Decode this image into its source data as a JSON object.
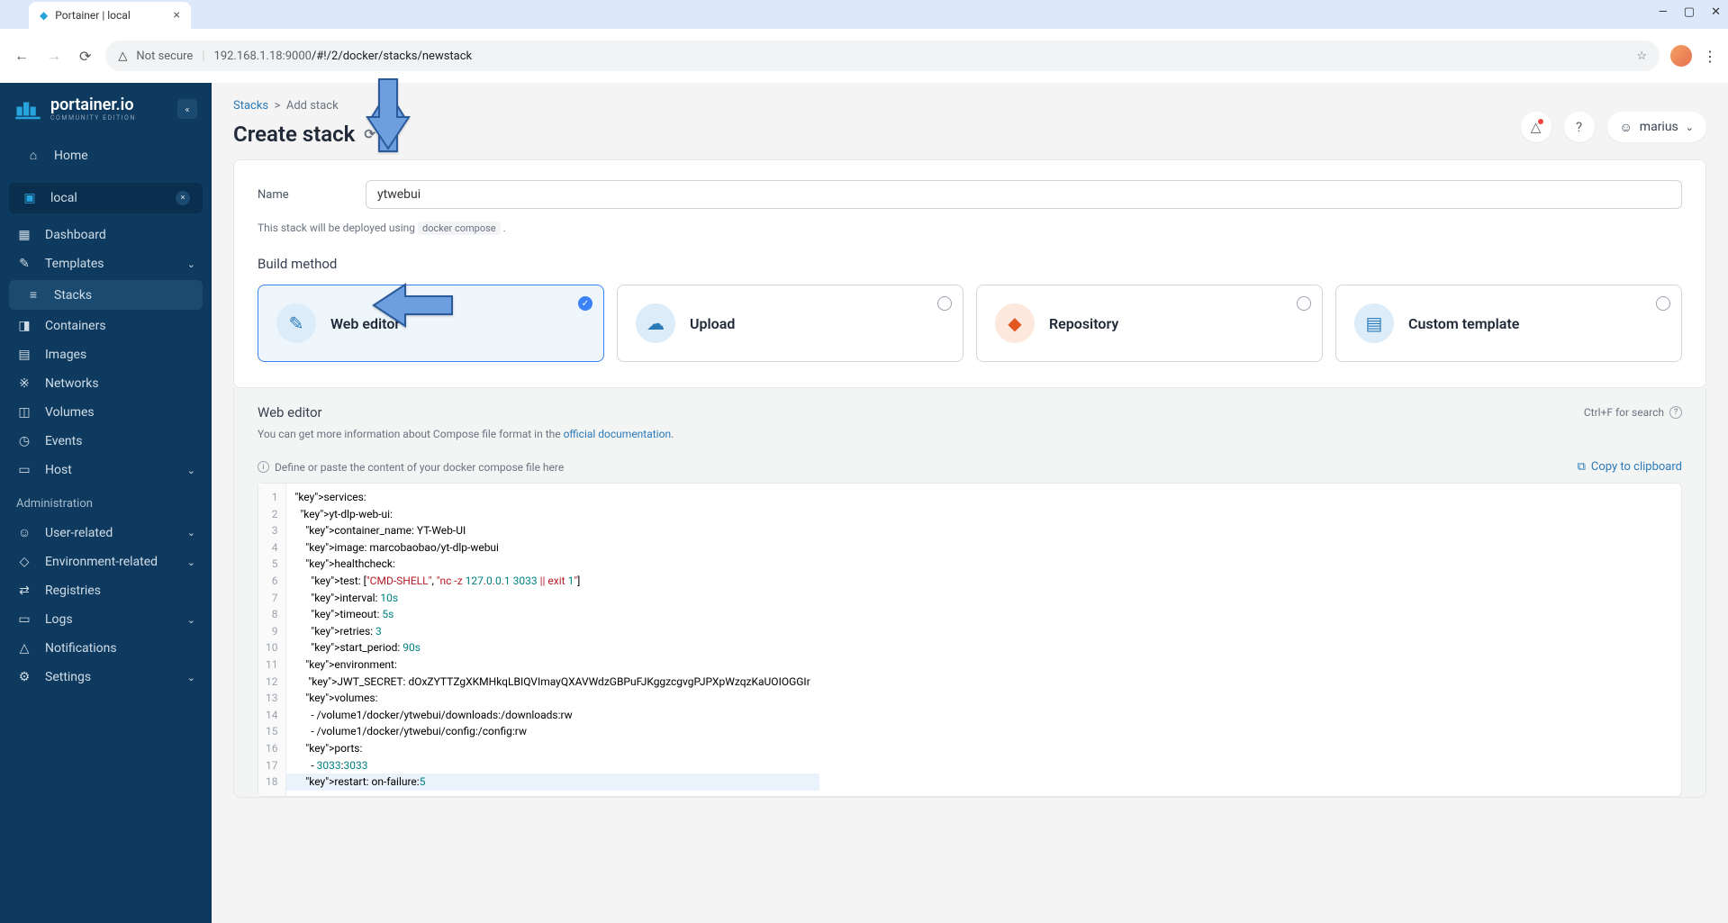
{
  "browser": {
    "tab_title": "Portainer | local",
    "security": "Not secure",
    "url_host": "192.168.1.18:9000",
    "url_path": "/#!/2/docker/stacks/newstack"
  },
  "sidebar": {
    "logo_main": "portainer.io",
    "logo_sub": "COMMUNITY EDITION",
    "home": "Home",
    "env_name": "local",
    "items": [
      {
        "label": "Dashboard"
      },
      {
        "label": "Templates"
      },
      {
        "label": "Stacks"
      },
      {
        "label": "Containers"
      },
      {
        "label": "Images"
      },
      {
        "label": "Networks"
      },
      {
        "label": "Volumes"
      },
      {
        "label": "Events"
      },
      {
        "label": "Host"
      }
    ],
    "admin_label": "Administration",
    "admin_items": [
      {
        "label": "User-related"
      },
      {
        "label": "Environment-related"
      },
      {
        "label": "Registries"
      },
      {
        "label": "Logs"
      },
      {
        "label": "Notifications"
      },
      {
        "label": "Settings"
      }
    ]
  },
  "breadcrumb": {
    "root": "Stacks",
    "current": "Add stack"
  },
  "page_title": "Create stack",
  "user_name": "marius",
  "form": {
    "name_label": "Name",
    "name_value": "ytwebui",
    "deploy_hint_a": "This stack will be deployed using ",
    "deploy_hint_code": "docker compose",
    "build_label": "Build method",
    "methods": [
      {
        "label": "Web editor"
      },
      {
        "label": "Upload"
      },
      {
        "label": "Repository"
      },
      {
        "label": "Custom template"
      }
    ]
  },
  "editor": {
    "title": "Web editor",
    "search_hint": "Ctrl+F for search",
    "info_a": "You can get more information about Compose file format in the ",
    "info_link": "official documentation",
    "paste_hint": "Define or paste the content of your docker compose file here",
    "copy_label": "Copy to clipboard"
  },
  "code_lines": [
    "services:",
    "  yt-dlp-web-ui:",
    "    container_name: YT-Web-UI",
    "    image: marcobaobao/yt-dlp-webui",
    "    healthcheck:",
    "      test: [\"CMD-SHELL\", \"nc -z 127.0.0.1 3033 || exit 1\"]",
    "      interval: 10s",
    "      timeout: 5s",
    "      retries: 3",
    "      start_period: 90s",
    "    environment:",
    "     JWT_SECRET: dOxZYTTZgXKMHkqLBIQVImayQXAVWdzGBPuFJKggzcgvgPJPXpWzqzKaUOIOGGIr",
    "    volumes:",
    "      - /volume1/docker/ytwebui/downloads:/downloads:rw",
    "      - /volume1/docker/ytwebui/config:/config:rw",
    "    ports:",
    "      - 3033:3033",
    "    restart: on-failure:5"
  ]
}
